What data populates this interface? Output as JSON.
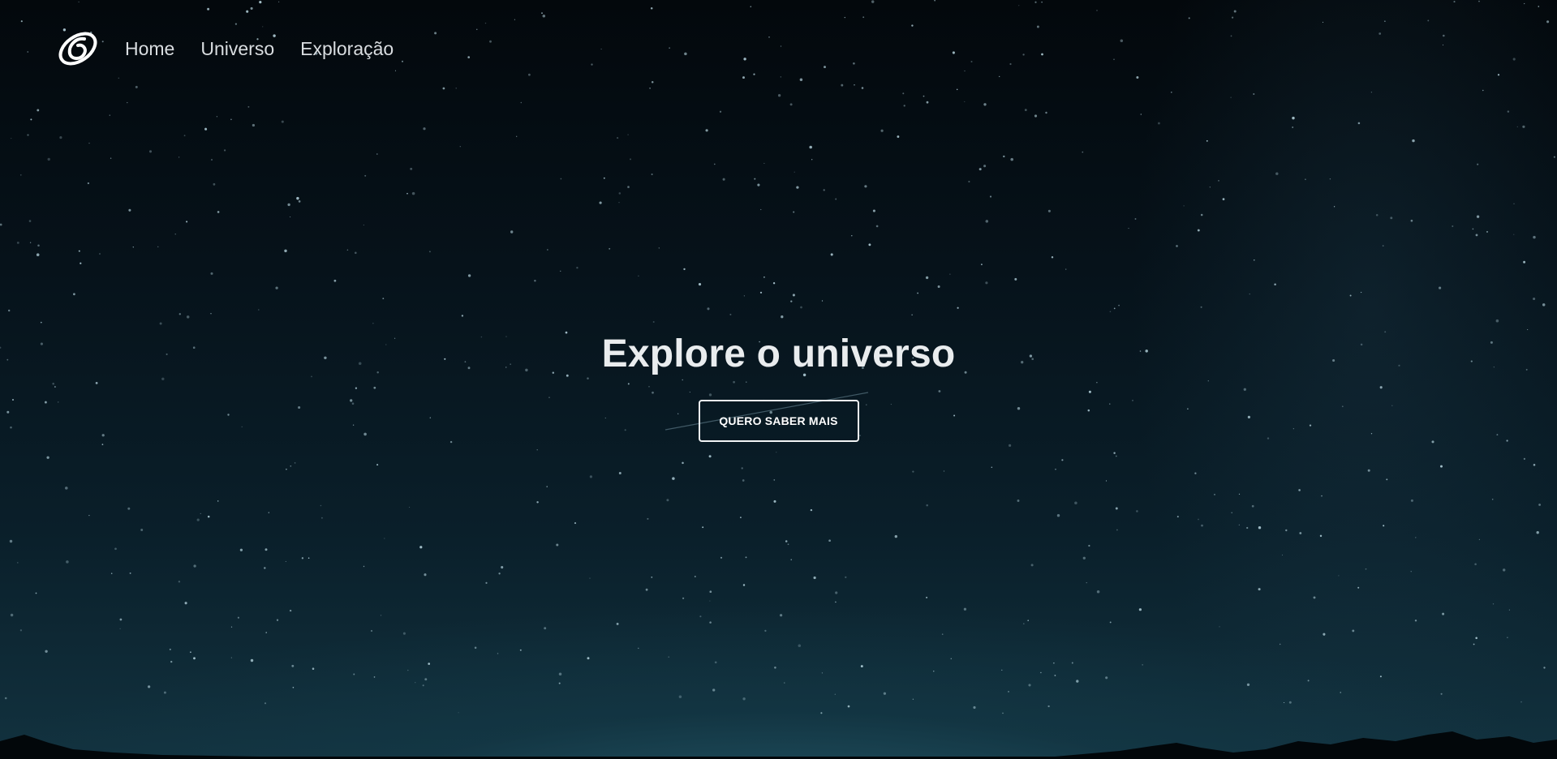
{
  "nav": {
    "logo_icon": "swirl-galaxy-icon",
    "items": [
      {
        "label": "Home"
      },
      {
        "label": "Universo"
      },
      {
        "label": "Exploração"
      }
    ]
  },
  "hero": {
    "title": "Explore o universo",
    "cta_label": "QUERO SABER MAIS"
  },
  "colors": {
    "text": "#e9ecee",
    "nav_text": "#d9dde0",
    "sky_top": "#03080c",
    "sky_bottom": "#12323f",
    "button_border": "#f2f4f5"
  }
}
